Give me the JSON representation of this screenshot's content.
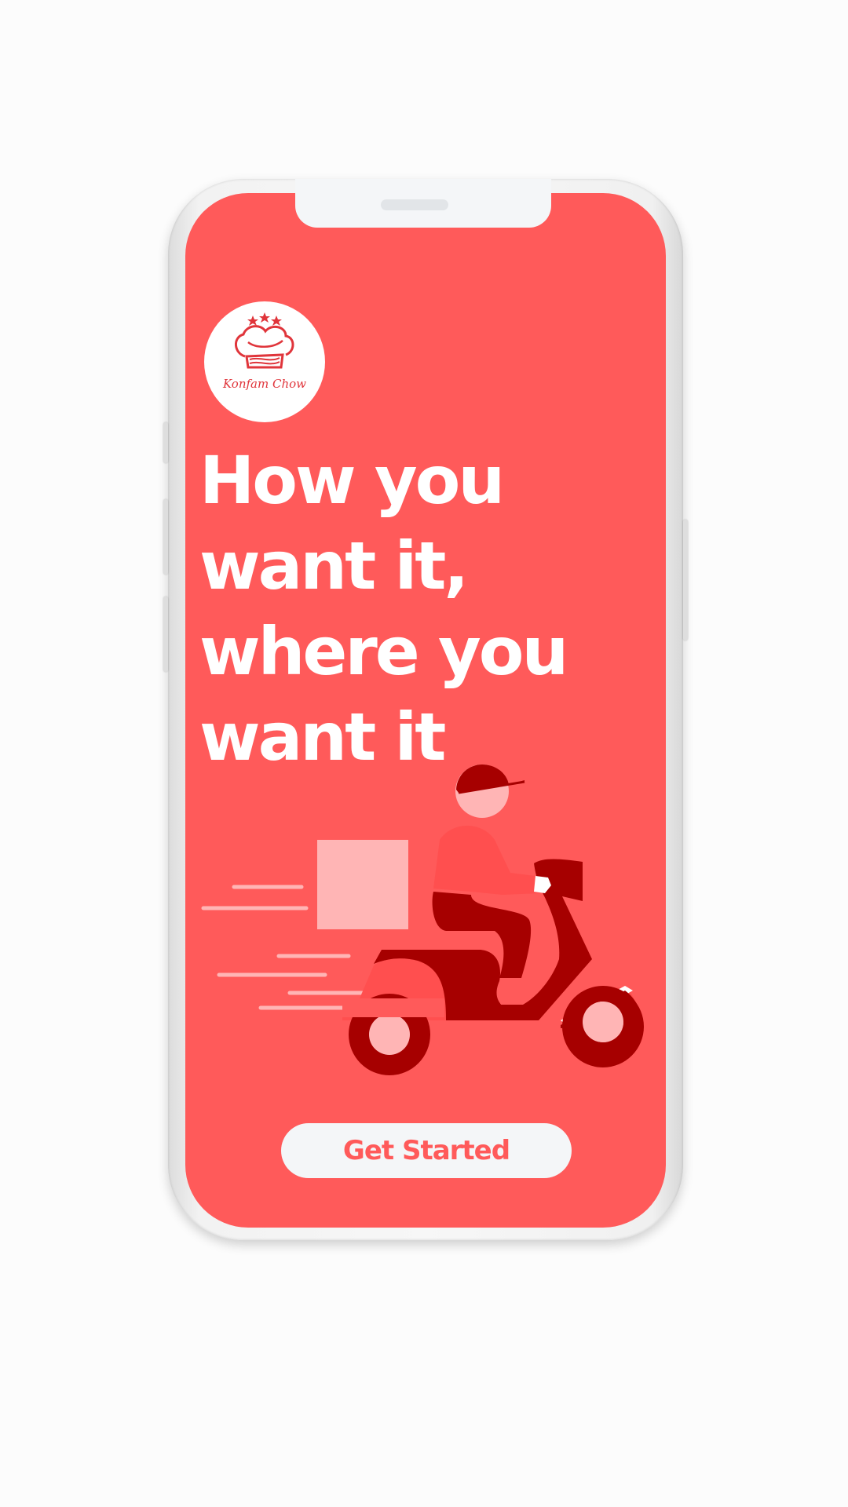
{
  "brand": {
    "name": "Konfam Chow"
  },
  "headline": {
    "line1": "How you",
    "line2": "want it,",
    "line3": "where you",
    "line4": "want it"
  },
  "cta": {
    "label": "Get Started"
  },
  "colors": {
    "primary": "#ff5a5a",
    "dark": "#a60000",
    "light": "#ffb5b5",
    "button_bg": "#f4f6f8"
  },
  "icons": [
    "chef-hat-logo-icon",
    "delivery-scooter-illustration"
  ]
}
